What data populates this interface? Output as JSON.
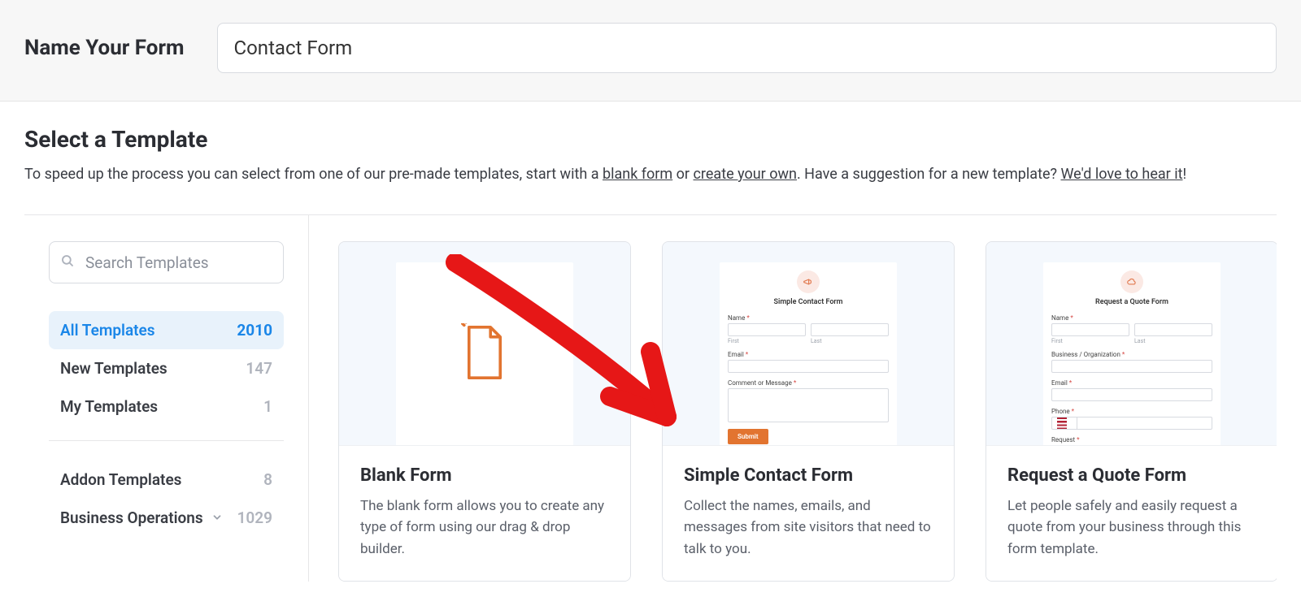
{
  "header": {
    "label": "Name Your Form",
    "value": "Contact Form"
  },
  "select": {
    "heading": "Select a Template",
    "sub_prefix": "To speed up the process you can select from one of our pre-made templates, start with a ",
    "link_blank": "blank form",
    "mid1": " or ",
    "link_create": "create your own",
    "mid2": ". Have a suggestion for a new template? ",
    "link_suggest": "We'd love to hear it",
    "suffix": "!"
  },
  "search": {
    "placeholder": "Search Templates"
  },
  "categories_main": [
    {
      "label": "All Templates",
      "count": "2010",
      "active": true
    },
    {
      "label": "New Templates",
      "count": "147",
      "active": false
    },
    {
      "label": "My Templates",
      "count": "1",
      "active": false
    }
  ],
  "categories_extra": [
    {
      "label": "Addon Templates",
      "count": "8",
      "expandable": false
    },
    {
      "label": "Business Operations",
      "count": "1029",
      "expandable": true
    }
  ],
  "templates": [
    {
      "title": "Blank Form",
      "desc": "The blank form allows you to create any type of form using our drag & drop builder.",
      "preview": "blank"
    },
    {
      "title": "Simple Contact Form",
      "desc": "Collect the names, emails, and messages from site visitors that need to talk to you.",
      "preview": "contact",
      "mini": {
        "heading": "Simple Contact Form",
        "name_label": "Name",
        "first": "First",
        "last": "Last",
        "email_label": "Email",
        "msg_label": "Comment or Message",
        "submit": "Submit"
      }
    },
    {
      "title": "Request a Quote Form",
      "desc": "Let people safely and easily request a quote from your business through this form template.",
      "preview": "quote",
      "mini": {
        "heading": "Request a Quote Form",
        "name_label": "Name",
        "first": "First",
        "last": "Last",
        "biz_label": "Business / Organization",
        "email_label": "Email",
        "phone_label": "Phone",
        "request_label": "Request"
      }
    }
  ]
}
